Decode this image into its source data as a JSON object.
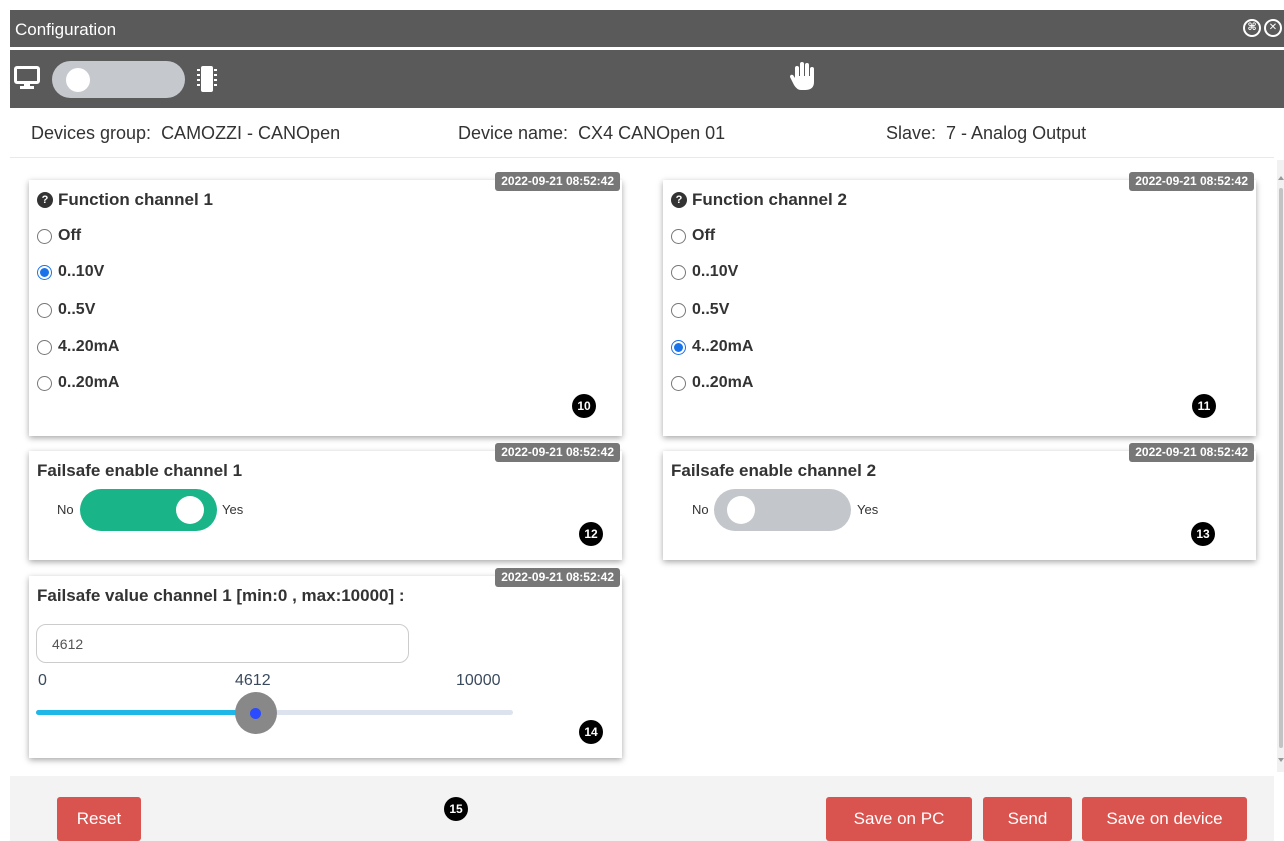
{
  "window": {
    "title": "Configuration",
    "icons": [
      "settings-circle-icon",
      "close-circle-icon"
    ]
  },
  "toolbar": {
    "left_icon": "monitor-icon",
    "right_icon": "chip-icon",
    "center_icon": "hand-icon",
    "mode_toggle_on": false
  },
  "info": {
    "group_label": "Devices group:",
    "group_value": "CAMOZZI - CANOpen",
    "device_label": "Device name:",
    "device_value": "CX4 CANOpen 01",
    "slave_label": "Slave:",
    "slave_value": "7 - Analog Output"
  },
  "function_channel_1": {
    "timestamp": "2022-09-21 08:52:42",
    "title": "Function channel 1",
    "options": [
      "Off",
      "0..10V",
      "0..5V",
      "4..20mA",
      "0..20mA"
    ],
    "selected": "0..10V",
    "badge": "10"
  },
  "function_channel_2": {
    "timestamp": "2022-09-21 08:52:42",
    "title": "Function channel 2",
    "options": [
      "Off",
      "0..10V",
      "0..5V",
      "4..20mA",
      "0..20mA"
    ],
    "selected": "4..20mA",
    "badge": "11"
  },
  "failsafe_enable_1": {
    "timestamp": "2022-09-21 08:52:42",
    "title": "Failsafe enable channel 1",
    "no_label": "No",
    "yes_label": "Yes",
    "enabled": true,
    "badge": "12"
  },
  "failsafe_enable_2": {
    "timestamp": "2022-09-21 08:52:42",
    "title": "Failsafe enable channel 2",
    "no_label": "No",
    "yes_label": "Yes",
    "enabled": false,
    "badge": "13"
  },
  "failsafe_value_1": {
    "timestamp": "2022-09-21 08:52:42",
    "title": "Failsafe value channel 1 [min:0 , max:10000] :",
    "input_value": "4612",
    "min_label": "0",
    "current_label": "4612",
    "max_label": "10000",
    "min": 0,
    "max": 10000,
    "value": 4612,
    "badge": "14"
  },
  "footer": {
    "reset_label": "Reset",
    "badge": "15",
    "save_pc_label": "Save on PC",
    "send_label": "Send",
    "save_device_label": "Save on device"
  },
  "colors": {
    "title_bar": "#5a5a5a",
    "switch_on": "#19b589",
    "switch_off": "#c3c7cc",
    "button": "#d9534f",
    "slider_fill": "#1fb6e8",
    "radio_checked": "#1a73e8"
  }
}
